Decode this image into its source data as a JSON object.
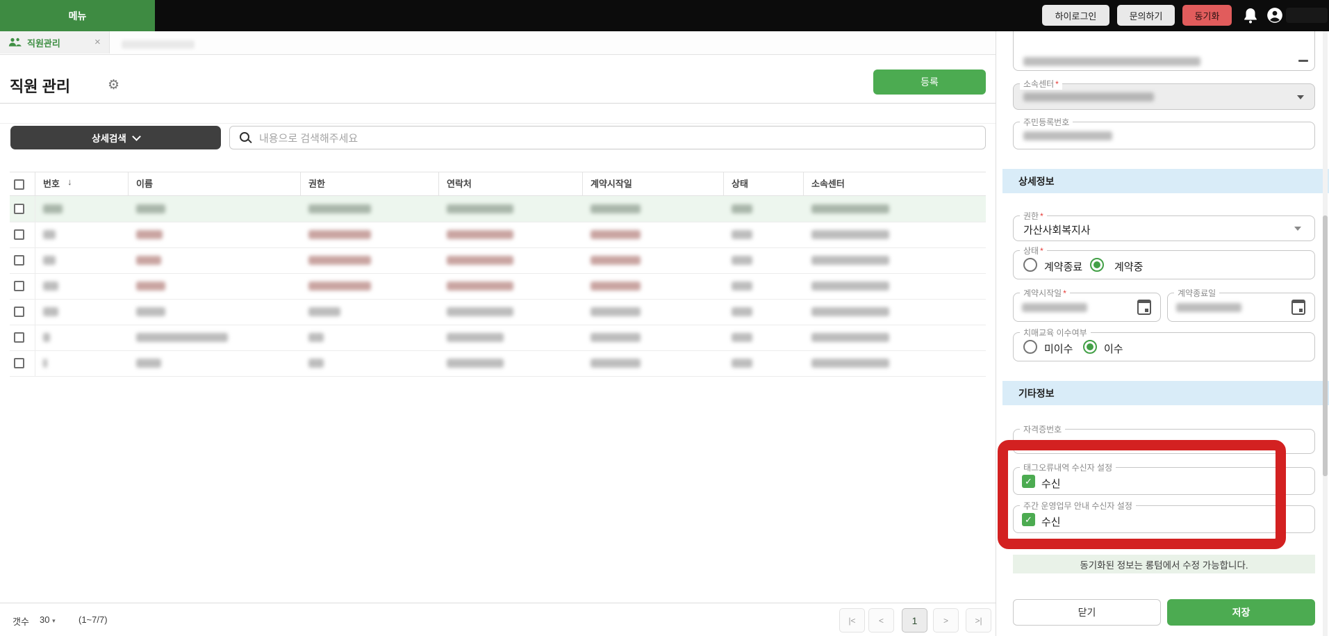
{
  "topbar": {
    "menu_label": "메뉴",
    "buttons": [
      {
        "label": "하이로그인"
      },
      {
        "label": "문의하기"
      },
      {
        "label": "동기화"
      }
    ]
  },
  "tab": {
    "label": "직원관리",
    "close_icon": "×"
  },
  "page": {
    "title": "직원 관리",
    "gear_icon": "⚙",
    "register_label": "등록"
  },
  "toolbar": {
    "detail_search_label": "상세검색",
    "search_placeholder": "내용으로 검색해주세요"
  },
  "table": {
    "headers": [
      "번호",
      "이름",
      "권한",
      "연락처",
      "계약시작일",
      "상태",
      "소속센터"
    ],
    "sort_icon": "↓",
    "rows": [
      {
        "variant": "selected",
        "blobs": [
          28,
          42,
          90,
          96,
          72,
          30,
          112
        ]
      },
      {
        "variant": "red",
        "blobs": [
          18,
          38,
          90,
          96,
          72,
          30,
          112
        ]
      },
      {
        "variant": "red",
        "blobs": [
          18,
          36,
          90,
          96,
          72,
          30,
          112
        ]
      },
      {
        "variant": "red",
        "blobs": [
          22,
          42,
          90,
          96,
          72,
          30,
          112
        ]
      },
      {
        "variant": "normal",
        "blobs": [
          22,
          42,
          46,
          96,
          72,
          30,
          112
        ]
      },
      {
        "variant": "normal",
        "blobs": [
          10,
          132,
          22,
          82,
          72,
          30,
          112
        ]
      },
      {
        "variant": "normal",
        "blobs": [
          6,
          36,
          22,
          82,
          72,
          30,
          112
        ]
      }
    ]
  },
  "footer": {
    "count_label": "갯수",
    "page_size": "30",
    "caret_icon": "▾",
    "range_label": "(1~7/7)",
    "pagination": [
      "|<",
      "<",
      "1",
      ">",
      ">|"
    ],
    "active_page": "1"
  },
  "panel": {
    "center_label": "소속센터",
    "rrn_label": "주민등록번호",
    "section_detail": "상세정보",
    "role_label": "권한",
    "role_value": "가산사회복지사",
    "status_label": "상태",
    "status_options": [
      "계약종료",
      "계약중"
    ],
    "status_selected": "계약중",
    "start_label": "계약시작일",
    "end_label": "계약종료일",
    "dementia_label": "치매교육 이수여부",
    "dementia_options": [
      "미이수",
      "이수"
    ],
    "dementia_selected": "이수",
    "section_etc": "기타정보",
    "license_label": "자격증번호",
    "tag_label": "태그오류내역 수신자 설정",
    "tag_checkbox_label": "수신",
    "tag_checked": true,
    "weekly_label": "주간 운영업무 안내 수신자 설정",
    "weekly_checkbox_label": "수신",
    "weekly_checked": true,
    "notice": "동기화된 정보는 롱텀에서 수정 가능합니다.",
    "close_label": "닫기",
    "save_label": "저장",
    "check_icon": "✓"
  },
  "colors": {
    "brand_green": "#3e8b42",
    "button_green": "#4cab51",
    "sync_red": "#e15c5c",
    "section_blue": "#d9ecf8",
    "notice_green": "#e9f2e8",
    "selected_row": "#edf6ee",
    "annotation_red": "#d32121"
  }
}
